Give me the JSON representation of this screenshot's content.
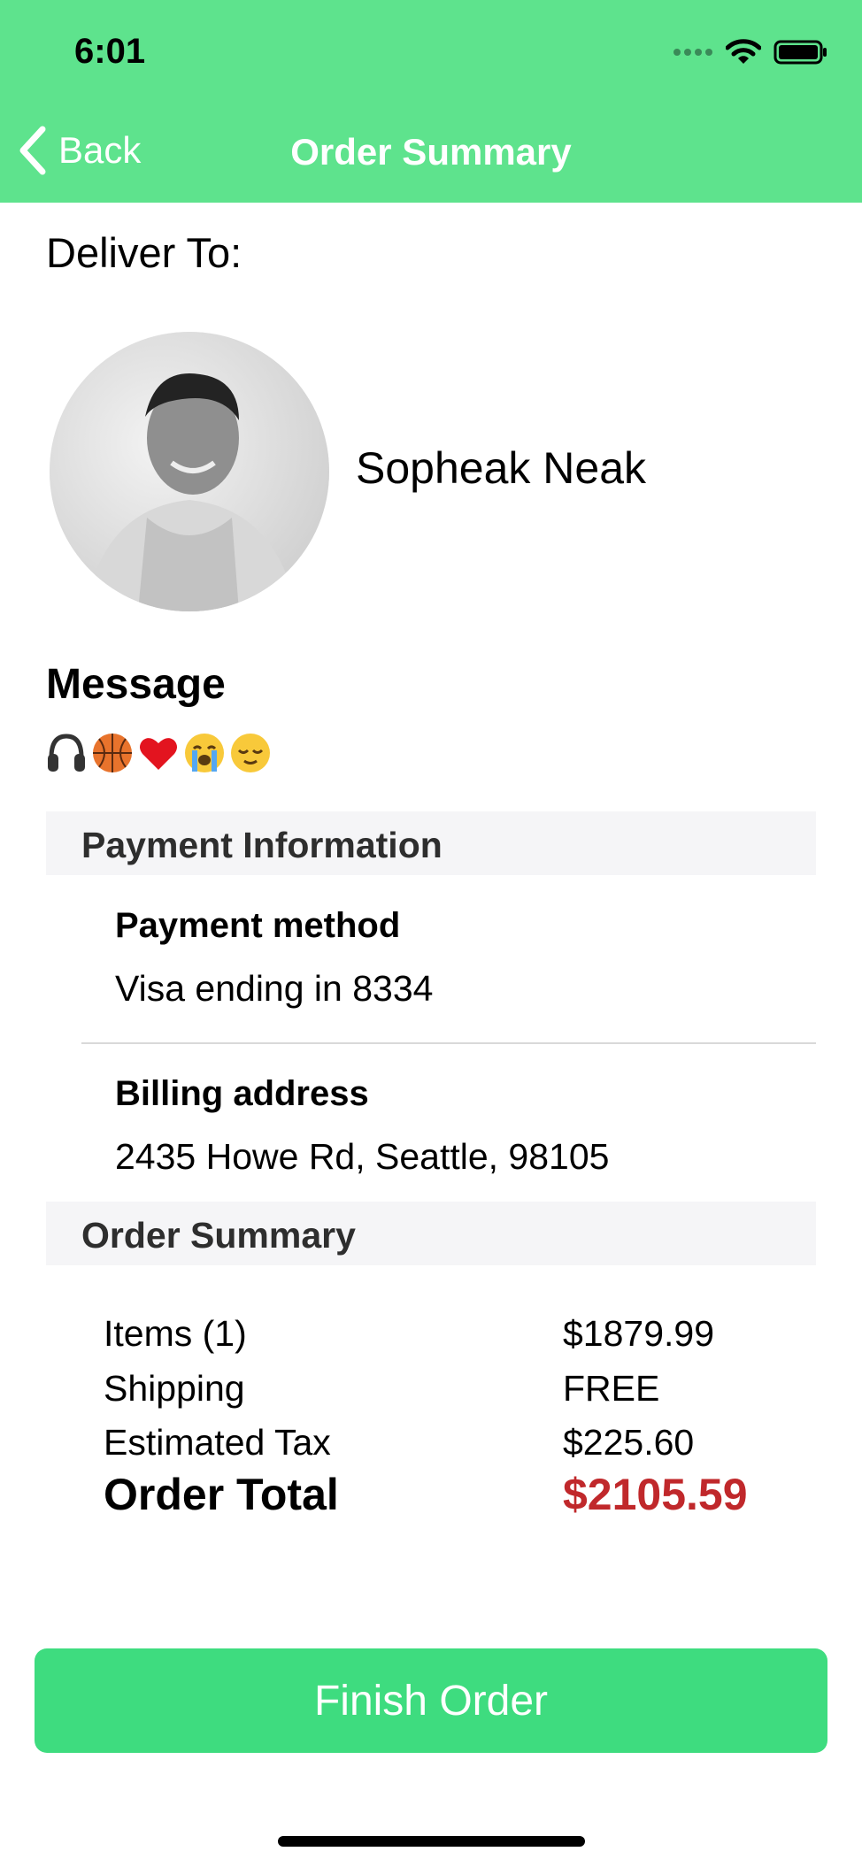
{
  "status_bar": {
    "time": "6:01"
  },
  "nav": {
    "back_label": "Back",
    "title": "Order Summary"
  },
  "delivery": {
    "label": "Deliver To:",
    "recipient_name": "Sopheak Neak"
  },
  "message": {
    "label": "Message",
    "emojis": [
      "headphones",
      "basketball",
      "red-heart",
      "loudly-crying-face",
      "relieved-face"
    ]
  },
  "payment": {
    "section_title": "Payment Information",
    "method_label": "Payment method",
    "method_value": "Visa ending in 8334",
    "billing_label": "Billing address",
    "billing_value": "2435 Howe Rd, Seattle,  98105"
  },
  "summary": {
    "section_title": "Order Summary",
    "rows": [
      {
        "label": "Items (1)",
        "value": "$1879.99"
      },
      {
        "label": "Shipping",
        "value": "FREE"
      },
      {
        "label": "Estimated Tax",
        "value": "$225.60"
      }
    ],
    "total_label": "Order Total",
    "total_value": "$2105.59"
  },
  "finish_button": {
    "label": "Finish Order"
  },
  "colors": {
    "header": "#5ee38d",
    "button": "#3edc7f",
    "total": "#c0282b"
  }
}
